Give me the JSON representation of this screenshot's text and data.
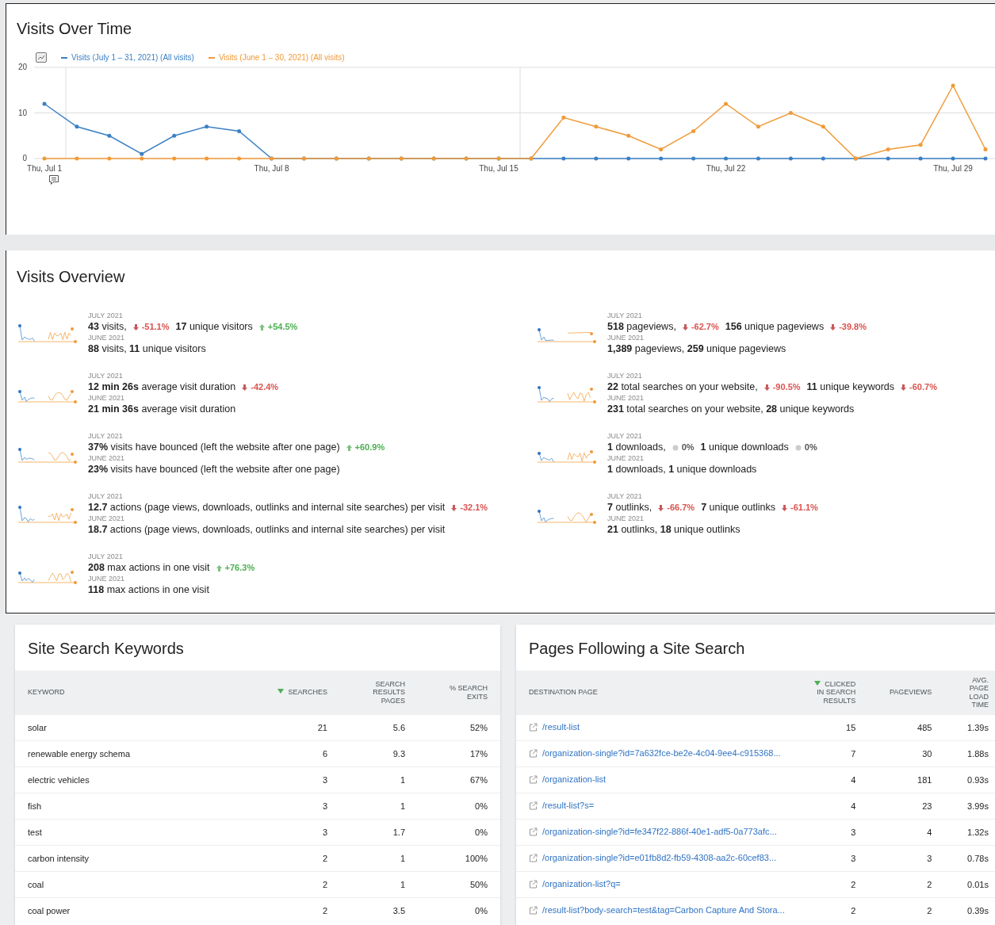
{
  "visits_over_time": {
    "title": "Visits Over Time",
    "chart_data": {
      "type": "line",
      "categories": [
        "Thu, Jul 1",
        null,
        null,
        null,
        null,
        null,
        null,
        "Thu, Jul 8",
        null,
        null,
        null,
        null,
        null,
        null,
        "Thu, Jul 15",
        null,
        null,
        null,
        null,
        null,
        null,
        "Thu, Jul 22",
        null,
        null,
        null,
        null,
        null,
        null,
        "Thu, Jul 29",
        null
      ],
      "yticks": [
        0,
        10,
        20
      ],
      "ylim": [
        0,
        20
      ],
      "series": [
        {
          "name": "Visits (July 1 – 31, 2021) (All visits)",
          "color": "#3b80c4",
          "values": [
            12,
            7,
            5,
            1,
            5,
            7,
            6,
            0,
            0,
            0,
            0,
            0,
            0,
            0,
            0,
            0,
            0,
            0,
            0,
            0,
            0,
            0,
            0,
            0,
            0,
            0,
            0,
            0,
            0,
            0
          ]
        },
        {
          "name": "Visits (June 1 – 30, 2021) (All visits)",
          "color": "#f09a38",
          "values": [
            0,
            0,
            0,
            0,
            0,
            0,
            0,
            0,
            0,
            0,
            0,
            0,
            0,
            0,
            0,
            0,
            9,
            7,
            5,
            2,
            6,
            12,
            7,
            10,
            7,
            0,
            2,
            3,
            16,
            2
          ]
        }
      ]
    }
  },
  "visits_overview": {
    "title": "Visits Overview",
    "columns": [
      {
        "items": [
          {
            "current_period": "JULY 2021",
            "current": [
              {
                "text": "**43** visits,",
                "change": "-51.1%",
                "kind": "down"
              },
              {
                "text": "**17** unique visitors",
                "change": "+54.5%",
                "kind": "up"
              }
            ],
            "previous_period": "JUNE 2021",
            "previous": "**88** visits, **11** unique visitors"
          },
          {
            "current_period": "JULY 2021",
            "current": [
              {
                "text": "**12 min 26s** average visit duration",
                "change": "-42.4%",
                "kind": "down"
              }
            ],
            "previous_period": "JUNE 2021",
            "previous": "**21 min 36s** average visit duration"
          },
          {
            "current_period": "JULY 2021",
            "current": [
              {
                "text": "**37%** visits have bounced (left the website after one page)",
                "change": "+60.9%",
                "kind": "up"
              }
            ],
            "previous_period": "JUNE 2021",
            "previous": "**23%** visits have bounced (left the website after one page)"
          },
          {
            "current_period": "JULY 2021",
            "current": [
              {
                "text": "**12.7** actions (page views, downloads, outlinks and internal site searches) per visit",
                "change": "-32.1%",
                "kind": "down"
              }
            ],
            "previous_period": "JUNE 2021",
            "previous": "**18.7** actions (page views, downloads, outlinks and internal site searches) per visit"
          },
          {
            "current_period": "JULY 2021",
            "current": [
              {
                "text": "**208** max actions in one visit",
                "change": "+76.3%",
                "kind": "up"
              }
            ],
            "previous_period": "JUNE 2021",
            "previous": "**118** max actions in one visit"
          }
        ]
      },
      {
        "items": [
          {
            "current_period": "JULY 2021",
            "current": [
              {
                "text": "**518** pageviews,",
                "change": "-62.7%",
                "kind": "down"
              },
              {
                "text": "**156** unique pageviews",
                "change": "-39.8%",
                "kind": "down"
              }
            ],
            "previous_period": "JUNE 2021",
            "previous": "**1,389** pageviews, **259** unique pageviews"
          },
          {
            "current_period": "JULY 2021",
            "current": [
              {
                "text": "**22** total searches on your website,",
                "change": "-90.5%",
                "kind": "down"
              },
              {
                "text": "**11** unique keywords",
                "change": "-60.7%",
                "kind": "down"
              }
            ],
            "previous_period": "JUNE 2021",
            "previous": "**231** total searches on your website, **28** unique keywords"
          },
          {
            "current_period": "JULY 2021",
            "current": [
              {
                "text": "**1** downloads,",
                "change": "0%",
                "kind": "flat"
              },
              {
                "text": "**1** unique downloads",
                "change": "0%",
                "kind": "flat"
              }
            ],
            "previous_period": "JUNE 2021",
            "previous": "**1** downloads, **1** unique downloads"
          },
          {
            "current_period": "JULY 2021",
            "current": [
              {
                "text": "**7** outlinks,",
                "change": "-66.7%",
                "kind": "down"
              },
              {
                "text": "**7** unique outlinks",
                "change": "-61.1%",
                "kind": "down"
              }
            ],
            "previous_period": "JUNE 2021",
            "previous": "**21** outlinks, **18** unique outlinks"
          }
        ]
      }
    ]
  },
  "site_search_keywords": {
    "title": "Site Search Keywords",
    "columns": [
      {
        "label": "KEYWORD",
        "sorted": false
      },
      {
        "label": "SEARCHES",
        "sorted": true
      },
      {
        "label": "SEARCH RESULTS PAGES",
        "sorted": false
      },
      {
        "label": "% SEARCH EXITS",
        "sorted": false
      }
    ],
    "rows": [
      [
        "solar",
        "21",
        "5.6",
        "52%"
      ],
      [
        "renewable energy schema",
        "6",
        "9.3",
        "17%"
      ],
      [
        "electric vehicles",
        "3",
        "1",
        "67%"
      ],
      [
        "fish",
        "3",
        "1",
        "0%"
      ],
      [
        "test",
        "3",
        "1.7",
        "0%"
      ],
      [
        "carbon intensity",
        "2",
        "1",
        "100%"
      ],
      [
        "coal",
        "2",
        "1",
        "50%"
      ],
      [
        "coal power",
        "2",
        "3.5",
        "0%"
      ]
    ]
  },
  "pages_following_site_search": {
    "title": "Pages Following a Site Search",
    "columns": [
      {
        "label": "DESTINATION PAGE",
        "sorted": false
      },
      {
        "label": "CLICKED IN SEARCH RESULTS",
        "sorted": true
      },
      {
        "label": "PAGEVIEWS",
        "sorted": false
      },
      {
        "label": "AVG. PAGE LOAD TIME",
        "sorted": false
      }
    ],
    "rows": [
      [
        "/result-list",
        "15",
        "485",
        "1.39s"
      ],
      [
        "/organization-single?id=7a632fce-be2e-4c04-9ee4-c915368...",
        "7",
        "30",
        "1.88s"
      ],
      [
        "/organization-list",
        "4",
        "181",
        "0.93s"
      ],
      [
        "/result-list?s=",
        "4",
        "23",
        "3.99s"
      ],
      [
        "/organization-single?id=fe347f22-886f-40e1-adf5-0a773afc...",
        "3",
        "4",
        "1.32s"
      ],
      [
        "/organization-single?id=e01fb8d2-fb59-4308-aa2c-60cef83...",
        "3",
        "3",
        "0.78s"
      ],
      [
        "/organization-list?q=",
        "2",
        "2",
        "0.01s"
      ],
      [
        "/result-list?body-search=test&tag=Carbon Capture And Stora...",
        "2",
        "2",
        "0.39s"
      ]
    ]
  }
}
